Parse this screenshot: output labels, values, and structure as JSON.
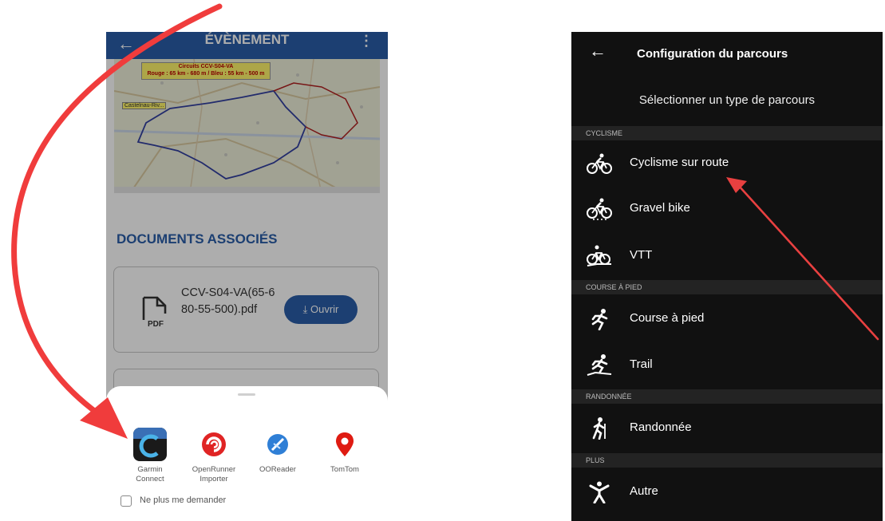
{
  "left": {
    "appbar": {
      "title": "ÉVÈNEMENT"
    },
    "map": {
      "legend_line1": "Circuits CCV-S04-VA",
      "legend_line2": "Rouge : 65 km - 680 m / Bleu : 55 km - 500 m",
      "callout": "Castelnau-Riv..."
    },
    "documents_title": "DOCUMENTS ASSOCIÉS",
    "document": {
      "filename": "CCV-S04-VA(65-680-55-500).pdf",
      "open_label": "Ouvrir",
      "icon_text": "PDF"
    },
    "sheet": {
      "apps": [
        {
          "name": "Garmin\nConnect",
          "icon": "garmin-connect-icon"
        },
        {
          "name": "OpenRunner\nImporter",
          "icon": "openrunner-icon"
        },
        {
          "name": "OOReader",
          "icon": "ooreader-icon"
        },
        {
          "name": "TomTom",
          "icon": "tomtom-icon"
        }
      ],
      "dont_ask_label": "Ne plus me demander"
    }
  },
  "right": {
    "title": "Configuration du parcours",
    "subtitle": "Sélectionner un type de parcours",
    "sections": [
      {
        "label": "CYCLISME",
        "items": [
          "Cyclisme sur route",
          "Gravel bike",
          "VTT"
        ]
      },
      {
        "label": "COURSE À PIED",
        "items": [
          "Course à pied",
          "Trail"
        ]
      },
      {
        "label": "RANDONNÉE",
        "items": [
          "Randonnée"
        ]
      },
      {
        "label": "PLUS",
        "items": [
          "Autre"
        ]
      }
    ]
  },
  "colors": {
    "primary_blue": "#2a5ea8",
    "annotation_red": "#f03c3c",
    "dark_bg": "#111111"
  }
}
